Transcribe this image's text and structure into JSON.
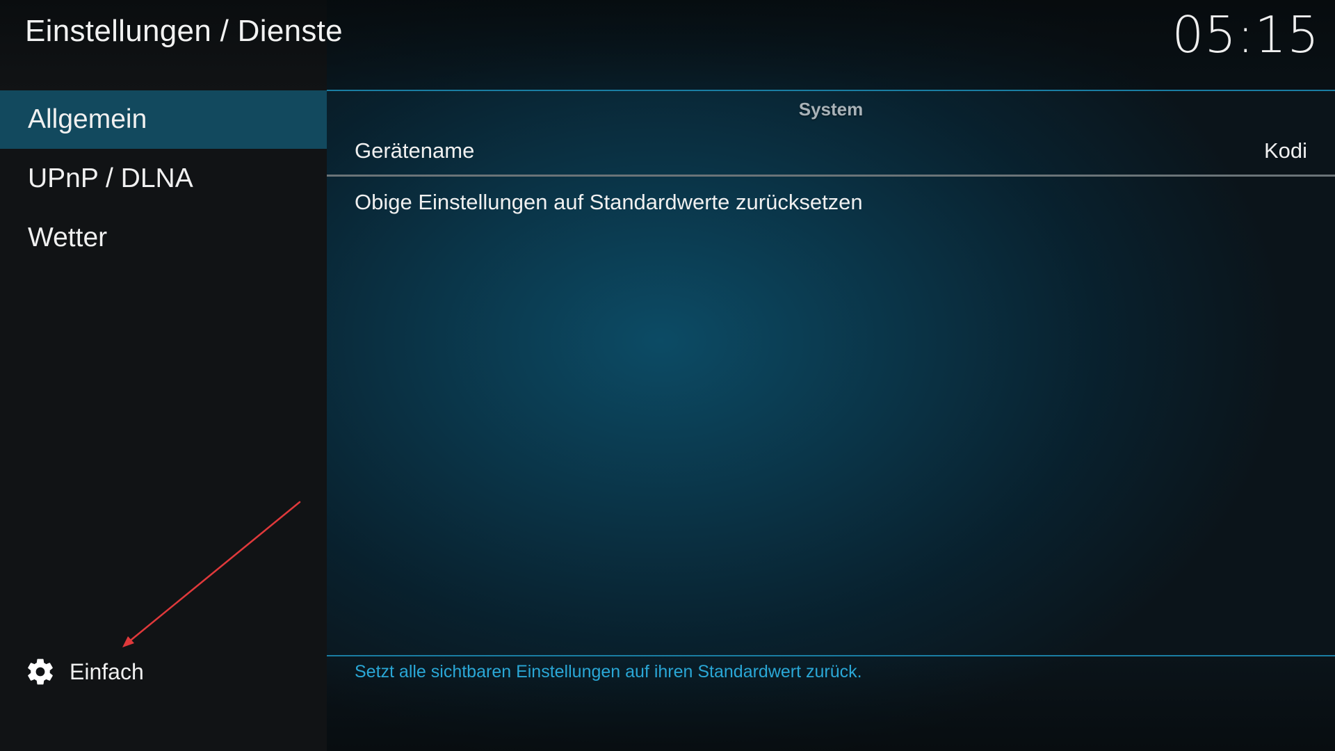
{
  "header": {
    "title": "Einstellungen / Dienste",
    "clock": "05:15"
  },
  "sidebar": {
    "items": [
      {
        "label": "Allgemein",
        "active": true
      },
      {
        "label": "UPnP / DLNA",
        "active": false
      },
      {
        "label": "Wetter",
        "active": false
      }
    ],
    "level": {
      "icon": "gear-icon",
      "label": "Einfach"
    }
  },
  "main": {
    "section_header": "System",
    "settings": [
      {
        "label": "Gerätename",
        "value": "Kodi"
      },
      {
        "label": "Obige Einstellungen auf Standardwerte zurücksetzen"
      }
    ],
    "hint": "Setzt alle sichtbaren Einstellungen auf ihren Standardwert zurück."
  },
  "colors": {
    "accent": "#1a7ea3",
    "active_item": "#12495e",
    "hint_text": "#2aa7d6",
    "annotation_arrow": "#e0393b"
  }
}
